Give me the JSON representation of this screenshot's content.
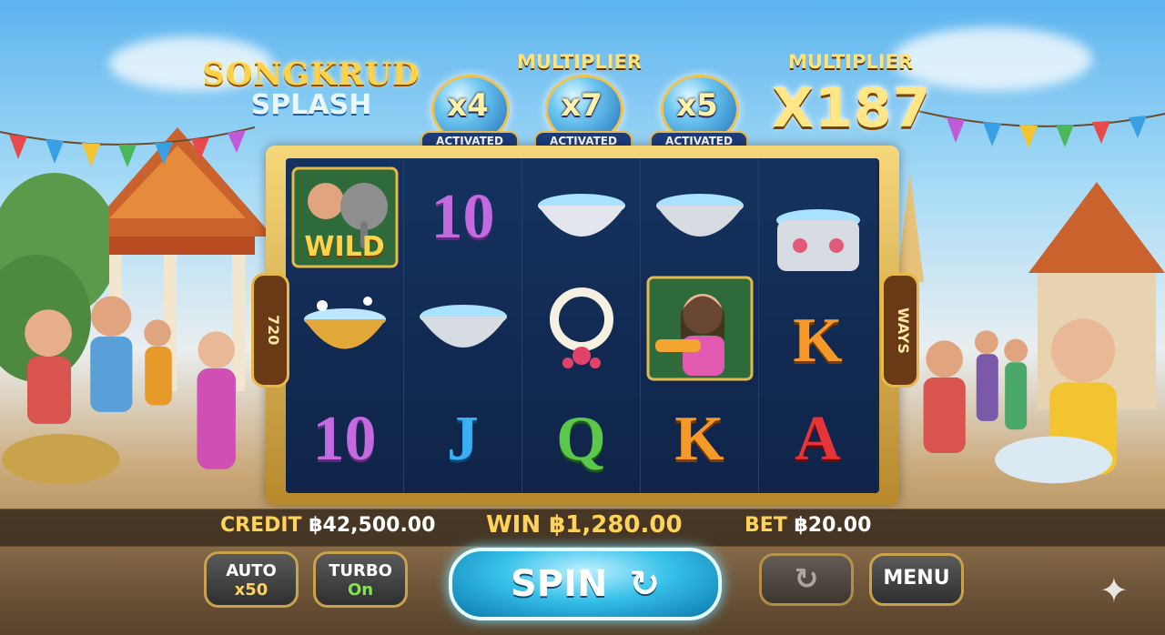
{
  "game": {
    "logo_line1": "SONGKRUD",
    "logo_line2": "SPLASH"
  },
  "multipliers": {
    "title_left": "MULTIPLIER",
    "title_right": "MULTIPLIER",
    "orbs": [
      {
        "value": "x4",
        "status": "ACTIVATED"
      },
      {
        "value": "x7",
        "status": "ACTIVATED"
      },
      {
        "value": "x5",
        "status": "ACTIVATED"
      }
    ],
    "total": "X187"
  },
  "ways": {
    "left": "720",
    "right": "WAYS"
  },
  "reels": {
    "wild_label": "WILD",
    "symbols": {
      "r1_row2": "10",
      "r3_row2": "J",
      "r3_row3": "Q",
      "r4_row3": "K",
      "r5_row2": "K",
      "r5_row3": "A",
      "r1_row3": "10"
    }
  },
  "bar": {
    "credit_label": "CREDIT",
    "credit_value": "฿42,500.00",
    "win_label": "WIN",
    "win_value": "฿1,280.00",
    "bet_label": "BET",
    "bet_value": "฿20.00"
  },
  "controls": {
    "auto_label": "AUTO",
    "auto_value": "x50",
    "turbo_label": "TURBO",
    "turbo_value": "On",
    "spin_label": "SPIN",
    "menu_label": "MENU"
  },
  "colors": {
    "accent_gold": "#f3c24d",
    "spin_blue": "#37c1e9",
    "panel_navy": "#13294f"
  }
}
